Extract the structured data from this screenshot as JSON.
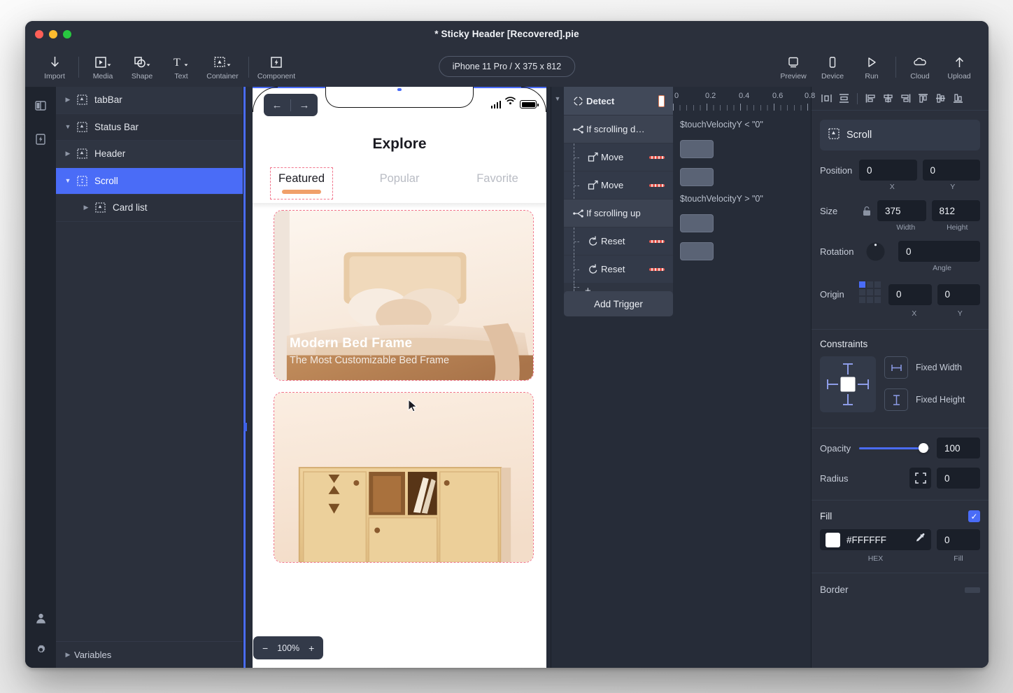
{
  "window": {
    "title": "* Sticky Header [Recovered].pie"
  },
  "toolbar": {
    "items": [
      {
        "label": "Import",
        "icon": "download-arrow-icon"
      },
      {
        "label": "Media",
        "icon": "media-play-icon"
      },
      {
        "label": "Shape",
        "icon": "shape-icon"
      },
      {
        "label": "Text",
        "icon": "text-t-icon"
      },
      {
        "label": "Container",
        "icon": "container-icon"
      },
      {
        "label": "Component",
        "icon": "component-bolt-icon"
      }
    ],
    "device_pill": "iPhone 11 Pro / X  375 x 812",
    "right_items": [
      {
        "label": "Preview",
        "icon": "preview-monitor-icon"
      },
      {
        "label": "Device",
        "icon": "device-phone-icon"
      },
      {
        "label": "Run",
        "icon": "run-play-icon"
      },
      {
        "label": "Cloud",
        "icon": "cloud-icon"
      },
      {
        "label": "Upload",
        "icon": "upload-arrow-icon"
      }
    ]
  },
  "rail": {
    "buttons": [
      {
        "name": "panels-toggle",
        "icon": "panel-layout-icon"
      },
      {
        "name": "interactions-toggle",
        "icon": "bolt-square-icon"
      }
    ],
    "bottom": [
      {
        "name": "account",
        "icon": "user-icon"
      },
      {
        "name": "settings",
        "icon": "gear-icon"
      }
    ]
  },
  "layers": {
    "items": [
      {
        "label": "tabBar",
        "expanded": false,
        "depth": 0,
        "selected": false
      },
      {
        "label": "Status Bar",
        "expanded": true,
        "depth": 0,
        "selected": false
      },
      {
        "label": "Header",
        "expanded": false,
        "depth": 0,
        "selected": false
      },
      {
        "label": "Scroll",
        "expanded": true,
        "depth": 0,
        "selected": true
      },
      {
        "label": "Card list",
        "expanded": false,
        "depth": 1,
        "selected": false
      }
    ],
    "variables_label": "Variables"
  },
  "canvas": {
    "zoom_label": "100%",
    "zoom_out": "−",
    "zoom_in": "+",
    "phone": {
      "title": "Explore",
      "tabs": [
        {
          "label": "Featured",
          "active": true
        },
        {
          "label": "Popular",
          "active": false
        },
        {
          "label": "Favorite",
          "active": false
        }
      ],
      "nav_back": "←",
      "nav_forward": "→",
      "cards": [
        {
          "title": "Modern Bed Frame",
          "subtitle": "The Most Customizable Bed Frame"
        },
        {
          "title": "",
          "subtitle": ""
        }
      ]
    }
  },
  "triggers": {
    "rows": [
      {
        "label": "Detect",
        "kind": "head",
        "icon": "detect-target-icon",
        "expr": "",
        "bar": false,
        "badge": false
      },
      {
        "label": "If scrolling d…",
        "kind": "cond",
        "icon": "branch-icon",
        "expr": "$touchVelocityY < \"0\"",
        "bar": false,
        "badge": false
      },
      {
        "label": "Move",
        "kind": "act",
        "icon": "move-arrow-icon",
        "expr": "",
        "bar": true,
        "badge": true
      },
      {
        "label": "Move",
        "kind": "act",
        "icon": "move-arrow-icon",
        "expr": "",
        "bar": true,
        "badge": true
      },
      {
        "label": "If scrolling up",
        "kind": "cond",
        "icon": "branch-icon",
        "expr": "$touchVelocityY > \"0\"",
        "bar": false,
        "badge": false
      },
      {
        "label": "Reset",
        "kind": "act",
        "icon": "reset-undo-icon",
        "expr": "",
        "bar": true,
        "badge": true
      },
      {
        "label": "Reset",
        "kind": "act",
        "icon": "reset-undo-icon",
        "expr": "",
        "bar": true,
        "badge": true
      },
      {
        "label": "+",
        "kind": "plus",
        "icon": "plus-icon",
        "expr": "",
        "bar": false,
        "badge": false
      }
    ],
    "add_trigger_label": "Add Trigger",
    "ruler_ticks": [
      "0",
      "0.2",
      "0.4",
      "0.6",
      "0.8"
    ]
  },
  "properties": {
    "layer_name": "Scroll",
    "position": {
      "label": "Position",
      "x": "0",
      "y": "0",
      "cap_x": "X",
      "cap_y": "Y"
    },
    "size": {
      "label": "Size",
      "width": "375",
      "height": "812",
      "cap_w": "Width",
      "cap_h": "Height",
      "lock_icon": "unlock-icon"
    },
    "rotation": {
      "label": "Rotation",
      "angle": "0",
      "cap": "Angle"
    },
    "origin": {
      "label": "Origin",
      "x": "0",
      "y": "0",
      "cap_x": "X",
      "cap_y": "Y"
    },
    "constraints": {
      "label": "Constraints",
      "fixed_width_label": "Fixed Width",
      "fixed_height_label": "Fixed Height"
    },
    "opacity": {
      "label": "Opacity",
      "value": "100"
    },
    "radius": {
      "label": "Radius",
      "value": "0",
      "icon": "corner-radius-icon"
    },
    "fill": {
      "label": "Fill",
      "hex": "#FFFFFF",
      "hex_cap": "HEX",
      "amount": "0",
      "amount_cap": "Fill",
      "checked": true,
      "eyedropper_icon": "eyedropper-icon",
      "swatch_color": "#FFFFFF"
    },
    "border": {
      "label": "Border"
    }
  },
  "colors": {
    "accent": "#4a6cf7",
    "panel": "#2b303c",
    "panel_dark": "#262c38",
    "selection_dashed": "#f1768c",
    "tab_underline": "#f0a06a"
  }
}
